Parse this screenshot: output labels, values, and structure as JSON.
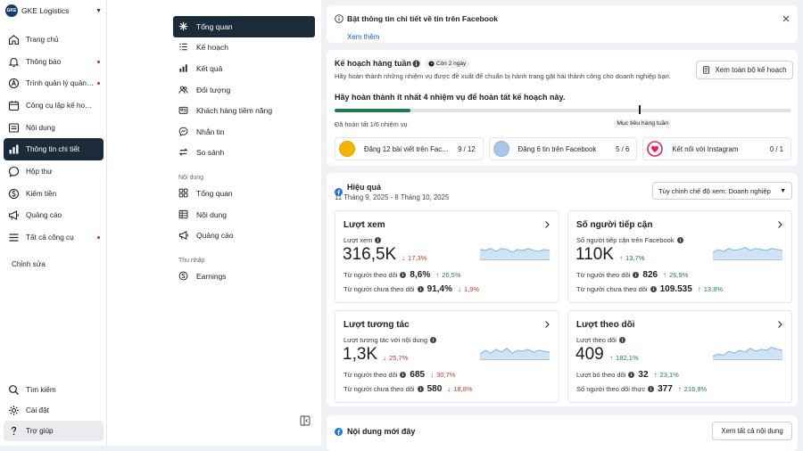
{
  "account": {
    "name": "GKE Logistics",
    "logo_text": "GKE"
  },
  "leftnav": {
    "items": [
      {
        "label": "Trang chủ",
        "icon": "home-icon"
      },
      {
        "label": "Thông báo",
        "icon": "bell-icon",
        "dot": true
      },
      {
        "label": "Trình quản lý quảng ...",
        "icon": "ads-manager-icon",
        "dot": true
      },
      {
        "label": "Công cụ lập kế hoạch",
        "icon": "calendar-icon"
      },
      {
        "label": "Nội dung",
        "icon": "content-icon"
      },
      {
        "label": "Thông tin chi tiết",
        "icon": "insights-icon",
        "active": true
      },
      {
        "label": "Hộp thư",
        "icon": "inbox-icon"
      },
      {
        "label": "Kiếm tiền",
        "icon": "dollar-icon"
      },
      {
        "label": "Quảng cáo",
        "icon": "megaphone-icon"
      },
      {
        "label": "Tất cả công cụ",
        "icon": "menu-icon",
        "dot": true
      }
    ],
    "edit_label": "Chỉnh sửa",
    "bottom": [
      {
        "label": "Tìm kiếm",
        "icon": "search-icon"
      },
      {
        "label": "Cài đặt",
        "icon": "gear-icon"
      },
      {
        "label": "Trợ giúp",
        "icon": "help-icon"
      }
    ]
  },
  "sectionnav": {
    "items": [
      {
        "label": "Tổng quan",
        "icon": "overview-icon",
        "active": true
      },
      {
        "label": "Kế hoạch",
        "icon": "plan-icon"
      },
      {
        "label": "Kết quả",
        "icon": "results-icon"
      },
      {
        "label": "Đối tượng",
        "icon": "audience-icon"
      },
      {
        "label": "Khách hàng tiềm năng",
        "icon": "leads-icon"
      },
      {
        "label": "Nhắn tin",
        "icon": "message-icon"
      },
      {
        "label": "So sánh",
        "icon": "compare-icon"
      }
    ],
    "content_heading": "Nội dung",
    "content_items": [
      {
        "label": "Tổng quan",
        "icon": "grid-icon"
      },
      {
        "label": "Nội dung",
        "icon": "table-icon"
      },
      {
        "label": "Quảng cáo",
        "icon": "megaphone-icon"
      }
    ],
    "income_heading": "Thu nhập",
    "income_items": [
      {
        "label": "Earnings",
        "icon": "earnings-icon"
      }
    ]
  },
  "banner": {
    "title": "Bật thông tin chi tiết về tin trên Facebook",
    "link": "Xem thêm"
  },
  "weekly": {
    "title": "Kế hoạch hàng tuần",
    "badge": "Còn 2 ngày",
    "description": "Hãy hoàn thành những nhiệm vụ được đề xuất để chuẩn bị hành trang gặt hái thành công cho doanh nghiệp bạn.",
    "view_button": "Xem toàn bộ kế hoạch",
    "goal": "Hãy hoàn thành ít nhất 4 nhiệm vụ để hoàn tất kế hoạch này.",
    "progress_label": "Đã hoàn tất 1/6 nhiệm vụ",
    "progress_fraction": 0.1667,
    "target_label": "Mục tiêu hàng tuần",
    "target_fraction": 0.6667,
    "tasks": [
      {
        "label": "Đăng 12 bài viết trên Faceb...",
        "count": "9 / 12",
        "color": "#f5b400"
      },
      {
        "label": "Đăng 6 tin trên Facebook",
        "count": "5 / 6",
        "color": "#a9c3ea"
      },
      {
        "label": "Kết nối với Instagram",
        "count": "0 / 1",
        "color": "#e0245e"
      }
    ]
  },
  "performance": {
    "title": "Hiệu quả",
    "date_range": "11 Tháng 9, 2025 - 8 Tháng 10, 2025",
    "view_mode": "Tùy chỉnh chế độ xem: Doanh nghiệp",
    "cards": [
      {
        "title": "Lượt xem",
        "subtitle": "Lượt xem",
        "value": "316,5K",
        "delta": "17,3%",
        "delta_dir": "down",
        "spark": [
          0.55,
          0.5,
          0.6,
          0.45,
          0.6,
          0.55,
          0.4,
          0.55,
          0.5,
          0.6,
          0.5,
          0.45,
          0.55,
          0.5
        ],
        "rows": [
          {
            "label": "Từ người theo dõi",
            "value": "8,6%",
            "delta": "26,5%",
            "dir": "up"
          },
          {
            "label": "Từ người chưa theo dõi",
            "value": "91,4%",
            "delta": "1,9%",
            "dir": "down"
          }
        ]
      },
      {
        "title": "Số người tiếp cận",
        "subtitle": "Số người tiếp cận trên Facebook",
        "value": "110K",
        "delta": "13,7%",
        "delta_dir": "up",
        "spark": [
          0.4,
          0.55,
          0.45,
          0.6,
          0.5,
          0.55,
          0.65,
          0.5,
          0.6,
          0.55,
          0.5,
          0.6,
          0.55,
          0.5
        ],
        "rows": [
          {
            "label": "Từ người theo dõi",
            "value": "826",
            "delta": "26,9%",
            "dir": "up"
          },
          {
            "label": "Từ người chưa theo dõi",
            "value": "109.535",
            "delta": "13,8%",
            "dir": "up"
          }
        ]
      },
      {
        "title": "Lượt tương tác",
        "subtitle": "Lượt tương tác với nội dung",
        "value": "1,3K",
        "delta": "25,7%",
        "delta_dir": "down",
        "spark": [
          0.3,
          0.5,
          0.35,
          0.55,
          0.4,
          0.6,
          0.35,
          0.5,
          0.45,
          0.55,
          0.4,
          0.5,
          0.45,
          0.4
        ],
        "rows": [
          {
            "label": "Từ người theo dõi",
            "value": "685",
            "delta": "30,7%",
            "dir": "down"
          },
          {
            "label": "Từ người chưa theo dõi",
            "value": "580",
            "delta": "18,8%",
            "dir": "down"
          }
        ]
      },
      {
        "title": "Lượt theo dõi",
        "subtitle": "Lượt theo dõi",
        "value": "409",
        "delta": "182,1%",
        "delta_dir": "up",
        "spark": [
          0.2,
          0.3,
          0.25,
          0.45,
          0.35,
          0.5,
          0.4,
          0.6,
          0.45,
          0.55,
          0.5,
          0.65,
          0.55,
          0.5
        ],
        "rows": [
          {
            "label": "Lượt bỏ theo dõi",
            "value": "32",
            "delta": "23,1%",
            "dir": "up"
          },
          {
            "label": "Số người theo dõi thực",
            "value": "377",
            "delta": "216,8%",
            "dir": "up"
          }
        ]
      }
    ]
  },
  "new_content": {
    "title": "Nội dung mới đây",
    "button": "Xem tất cả nội dung"
  }
}
